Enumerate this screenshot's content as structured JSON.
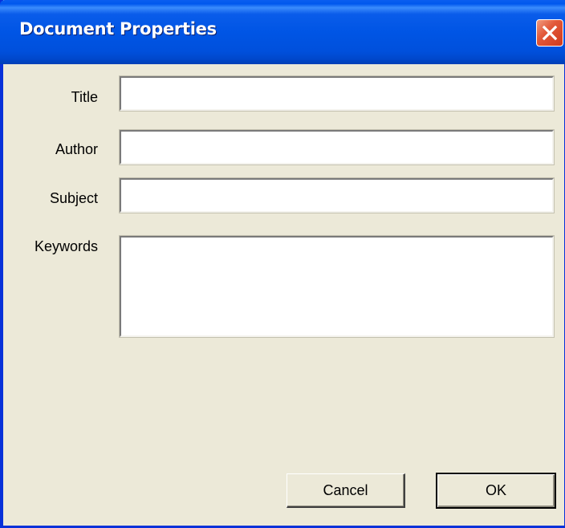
{
  "window": {
    "title": "Document Properties"
  },
  "fields": {
    "title_label": "Title",
    "title_value": "",
    "author_label": "Author",
    "author_value": "",
    "subject_label": "Subject",
    "subject_value": "",
    "keywords_label": "Keywords",
    "keywords_value": ""
  },
  "buttons": {
    "cancel_label": "Cancel",
    "ok_label": "OK"
  },
  "colors": {
    "titlebar": "#0055e5",
    "dialog_bg": "#ece9d8",
    "close_button": "#e2593a"
  },
  "icons": {
    "close": "close-x-icon"
  }
}
